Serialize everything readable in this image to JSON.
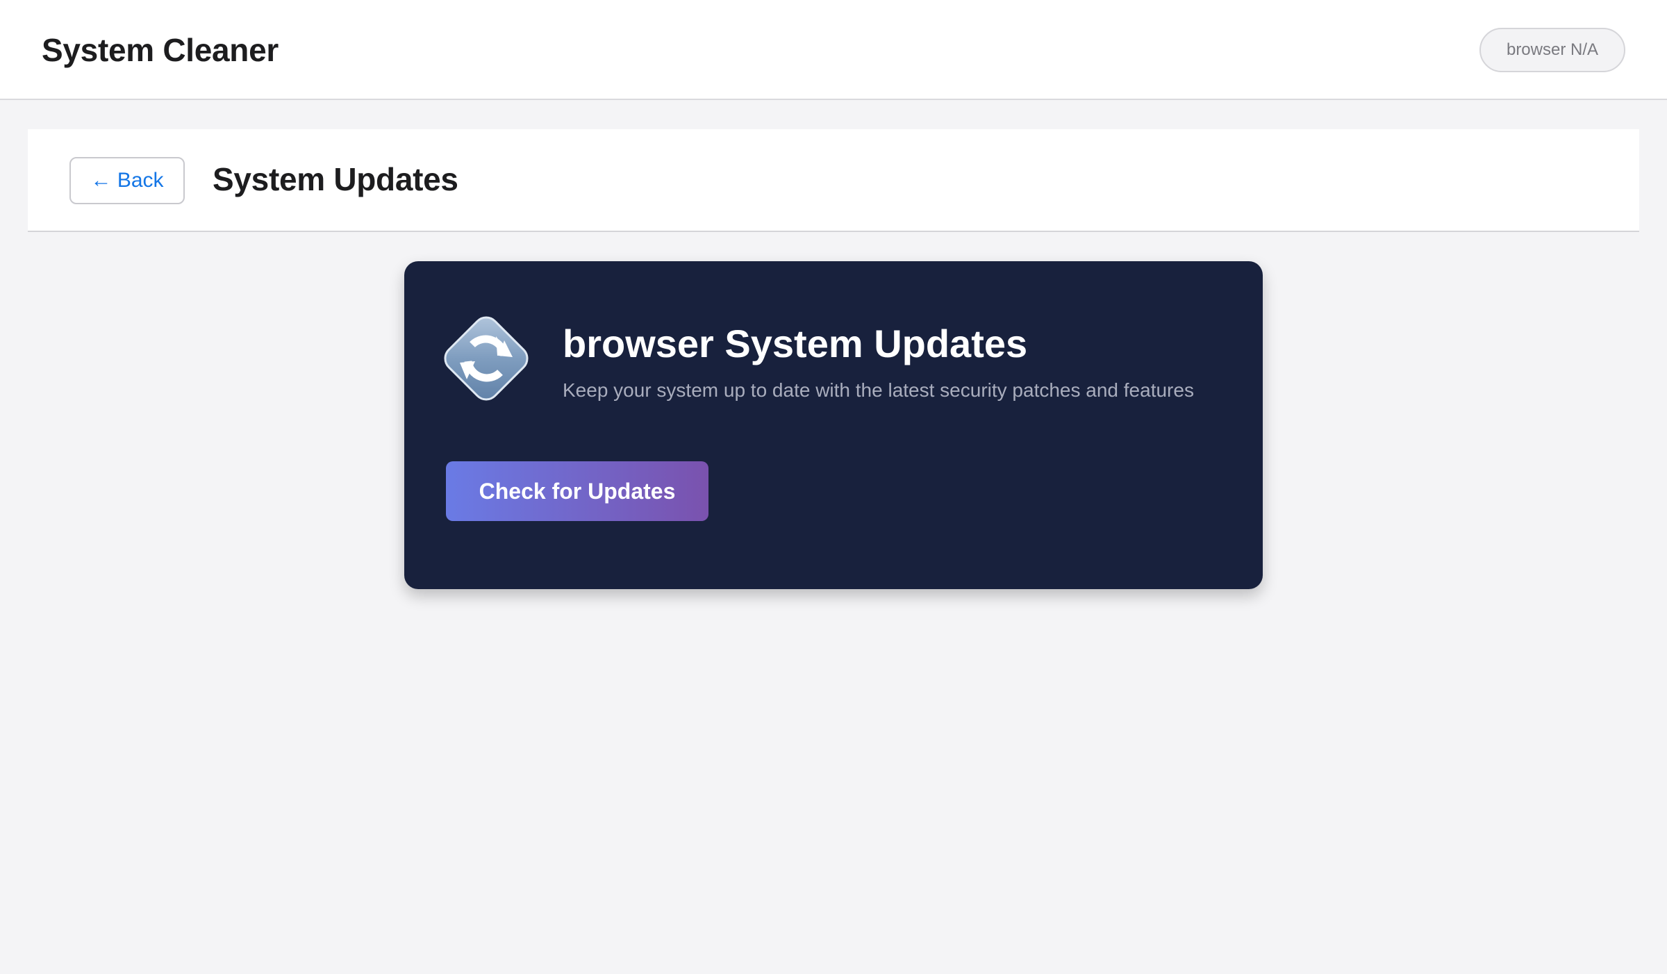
{
  "header": {
    "app_title": "System Cleaner",
    "browser_badge": "browser N/A"
  },
  "page_bar": {
    "back_label": "← Back",
    "page_title": "System Updates"
  },
  "card": {
    "icon": "refresh-icon",
    "title": "browser System Updates",
    "subtitle": "Keep your system up to date with the latest security patches and features",
    "check_button_label": "Check for Updates"
  },
  "colors": {
    "card_background": "#18213d",
    "button_gradient_start": "#6a7be5",
    "button_gradient_end": "#7a52ae",
    "link_blue": "#1476e6"
  }
}
